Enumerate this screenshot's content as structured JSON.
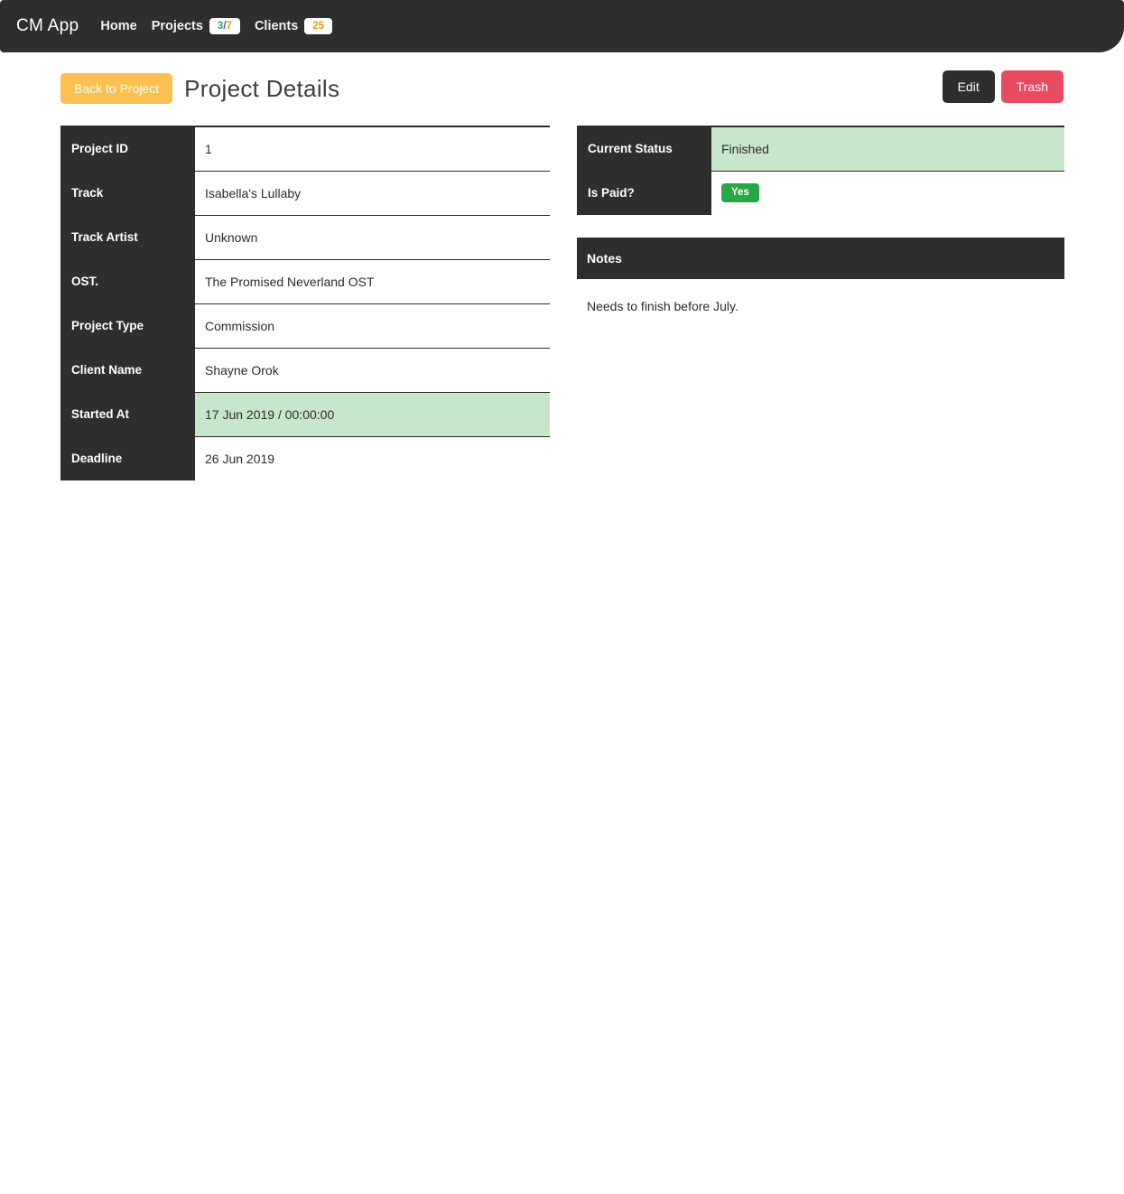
{
  "navbar": {
    "brand": "CM App",
    "items": [
      {
        "label": "Home",
        "badge": null
      },
      {
        "label": "Projects",
        "badge": {
          "first": "3",
          "sep": "/",
          "second": "7"
        }
      },
      {
        "label": "Clients",
        "badge_simple": "25"
      }
    ]
  },
  "header": {
    "back_label": "Back to Project",
    "title": "Project Details",
    "edit_label": "Edit",
    "trash_label": "Trash"
  },
  "details": {
    "rows": [
      {
        "label": "Project ID",
        "value": "1"
      },
      {
        "label": "Track",
        "value": "Isabella's Lullaby"
      },
      {
        "label": "Track Artist",
        "value": "Unknown"
      },
      {
        "label": "OST.",
        "value": "The Promised Neverland OST"
      },
      {
        "label": "Project Type",
        "value": "Commission"
      },
      {
        "label": "Client Name",
        "value": "Shayne Orok"
      },
      {
        "label": "Started At",
        "value": "17 Jun 2019 / 00:00:00",
        "highlight": true
      },
      {
        "label": "Deadline",
        "value": "26 Jun 2019"
      }
    ]
  },
  "status": {
    "rows": [
      {
        "label": "Current Status",
        "value": "Finished",
        "highlight": true
      },
      {
        "label": "Is Paid?",
        "pill": "Yes"
      }
    ]
  },
  "notes": {
    "header": "Notes",
    "body": "Needs to finish before July."
  },
  "colors": {
    "dark": "#2e2e2e",
    "accent_yellow": "#fbc04f",
    "danger_red": "#e84b60",
    "success_green": "#28a745",
    "highlight_green": "#c8e6c9"
  }
}
